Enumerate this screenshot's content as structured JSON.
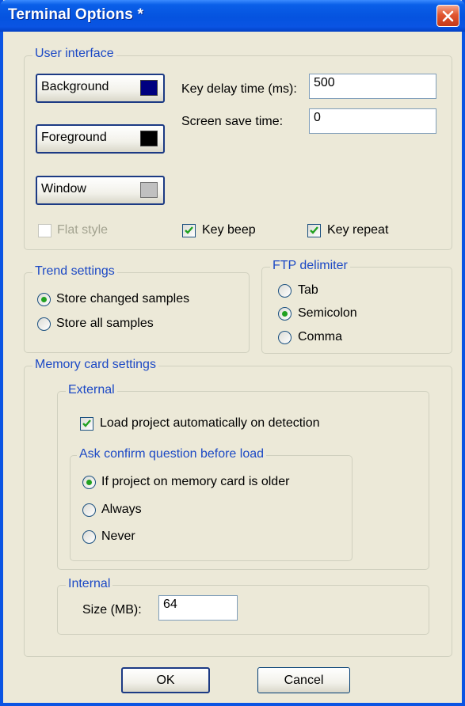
{
  "window": {
    "title": "Terminal Options *"
  },
  "user_interface": {
    "label": "User interface",
    "background_label": "Background",
    "background_color": "#000080",
    "foreground_label": "Foreground",
    "foreground_color": "#000000",
    "window_label": "Window",
    "window_color": "#c0c0c0",
    "key_delay_label": "Key delay time (ms):",
    "key_delay_value": "500",
    "screen_save_label": "Screen save time:",
    "screen_save_value": "0",
    "flat_style_label": "Flat style",
    "flat_style_checked": false,
    "key_beep_label": "Key beep",
    "key_beep_checked": true,
    "key_repeat_label": "Key repeat",
    "key_repeat_checked": true
  },
  "trend": {
    "label": "Trend settings",
    "options": [
      "Store changed samples",
      "Store all samples"
    ],
    "selected": "Store changed samples"
  },
  "ftp": {
    "label": "FTP delimiter",
    "options": [
      "Tab",
      "Semicolon",
      "Comma"
    ],
    "selected": "Semicolon"
  },
  "memory": {
    "label": "Memory card settings",
    "external": {
      "label": "External",
      "load_auto_label": "Load project automatically on detection",
      "load_auto_checked": true,
      "confirm": {
        "label": "Ask confirm question before load",
        "options": [
          "If project on memory card is older",
          "Always",
          "Never"
        ],
        "selected": "If project on memory card is older"
      }
    },
    "internal": {
      "label": "Internal",
      "size_label": "Size (MB):",
      "size_value": "64"
    }
  },
  "buttons": {
    "ok": "OK",
    "cancel": "Cancel"
  },
  "colors": {
    "titlebar": "#0a54e3",
    "group_label": "#1c49c5",
    "check_mark": "#21a121",
    "face": "#ece9d8"
  }
}
